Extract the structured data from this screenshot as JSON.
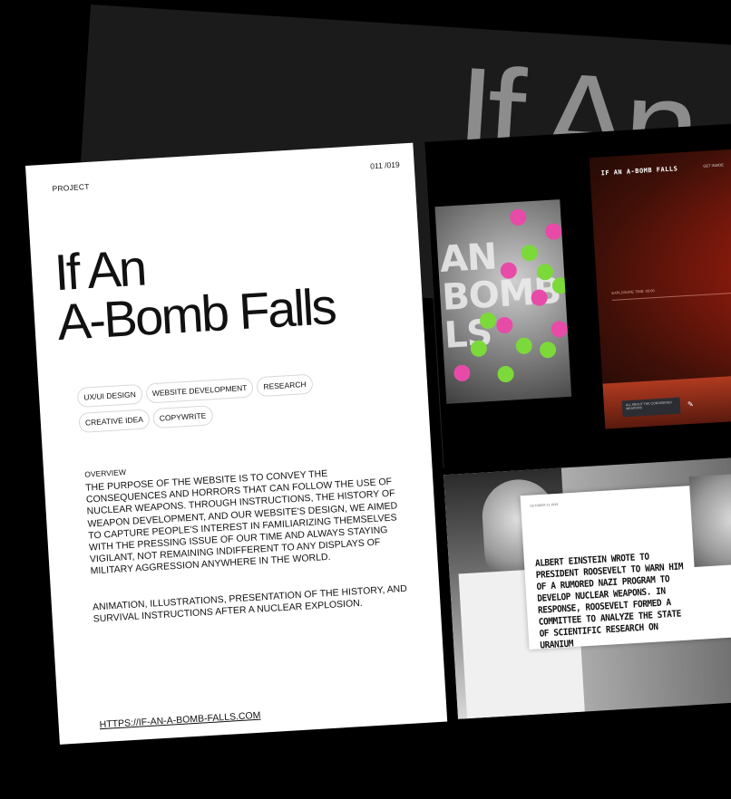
{
  "background": {
    "big_title": "If An"
  },
  "project": {
    "label": "PROJECT",
    "page_counter": "011  /019",
    "title_line1": "If An",
    "title_line2": "A-Bomb Falls",
    "tags": [
      "UX/UI DESIGN",
      "WEBSITE DEVELOPMENT",
      "RESEARCH",
      "CREATIVE IDEA",
      "COPYWRITE"
    ],
    "overview_label": "OVERVIEW",
    "overview_text": "THE PURPOSE OF THE WEBSITE IS TO CONVEY THE CONSEQUENCES AND HORRORS THAT CAN FOLLOW THE USE OF NUCLEAR WEAPONS. THROUGH INSTRUCTIONS, THE HISTORY OF WEAPON DEVELOPMENT, AND OUR WEBSITE'S DESIGN, WE AIMED TO CAPTURE PEOPLE'S INTEREST IN FAMILIARIZING THEMSELVES WITH THE PRESSING ISSUE OF OUR TIME AND ALWAYS STAYING VIGILANT, NOT REMAINING INDIFFERENT TO ANY DISPLAYS OF MILITARY AGGRESSION ANYWHERE IN THE WORLD.",
    "overview_text2": "ANIMATION, ILLUSTRATIONS, PRESENTATION OF THE HISTORY, AND SURVIVAL INSTRUCTIONS AFTER A NUCLEAR EXPLOSION.",
    "link": "HTTPS://IF-AN-A-BOMB-FALLS.COM"
  },
  "preview_bomb": {
    "word": "AN\nBOMB\nLS"
  },
  "preview_site": {
    "logo": "IF AN A-BOMB FALLS",
    "nav": "GET INSIDE",
    "caption": "EXPLOSURE TIME: 00:00",
    "button": "ALL ABOUT THE CONSIDERED WEAPONS"
  },
  "preview_history": {
    "date": "OCTOBER 21 1939",
    "text": "ALBERT EINSTEIN WROTE TO PRESIDENT ROOSEVELT TO WARN HIM OF A RUMORED NAZI PROGRAM TO DEVELOP NUCLEAR WEAPONS. IN RESPONSE, ROOSEVELT FORMED A COMMITTEE TO ANALYZE THE STATE OF SCIENTIFIC RESEARCH ON URANIUM"
  },
  "colors": {
    "accent_pink": "#e84aa8",
    "accent_green": "#7cd93a",
    "red_glow": "#c8321a"
  }
}
